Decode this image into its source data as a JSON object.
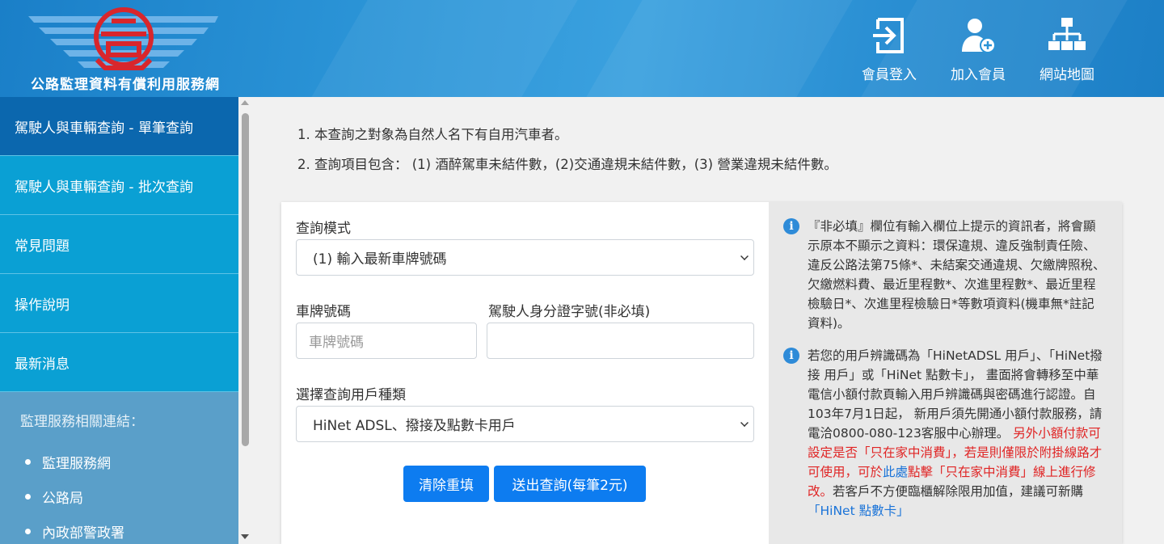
{
  "header": {
    "site_title": "公路監理資料有償利用服務網",
    "nav": [
      {
        "label": "會員登入",
        "icon": "login-icon"
      },
      {
        "label": "加入會員",
        "icon": "add-user-icon"
      },
      {
        "label": "網站地圖",
        "icon": "sitemap-icon"
      }
    ]
  },
  "sidebar": {
    "items": [
      {
        "label": "駕駛人與車輛查詢 - 單筆查詢",
        "active": true
      },
      {
        "label": "駕駛人與車輛查詢 - 批次查詢",
        "active": false
      },
      {
        "label": "常見問題",
        "active": false
      },
      {
        "label": "操作說明",
        "active": false
      },
      {
        "label": "最新消息",
        "active": false
      }
    ],
    "links_title": "監理服務相關連結：",
    "links": [
      "監理服務網",
      "公路局",
      "內政部警政署"
    ]
  },
  "notes": [
    "1. 本查詢之對象為自然人名下有自用汽車者。",
    "2. 查詢項目包含： (1) 酒醉駕車未結件數，(2)交通違規未結件數，(3) 營業違規未結件數。"
  ],
  "form": {
    "mode_label": "查詢模式",
    "mode_value": "(1) 輸入最新車牌號碼",
    "plate_label": "車牌號碼",
    "plate_placeholder": "車牌號碼",
    "plate_value": "",
    "id_label": "駕駛人身分證字號(非必填)",
    "id_value": "",
    "user_type_label": "選擇查詢用戶種類",
    "user_type_value": "HiNet ADSL、撥接及點數卡用戶",
    "clear_button": "清除重填",
    "submit_button": "送出查詢(每筆2元)"
  },
  "info": {
    "block1": "『非必填』欄位有輸入欄位上提示的資訊者，將會顯示原本不顯示之資料：環保違規、違反強制責任險、違反公路法第75條*、未結案交通違規、欠繳牌照稅、欠繳燃料費、最近里程數*、次進里程數*、最近里程檢驗日*、次進里程檢驗日*等數項資料(機車無*註記資料)。",
    "block2_part1": "若您的用戶辨識碼為「HiNetADSL 用戶」、「HiNet撥接 用戶」或「HiNet 點數卡」， 畫面將會轉移至中華電信小額付款頁輸入用戶辨識碼與密碼進行認證。自103年7月1日起， 新用戶須先開通小額付款服務，請電洽0800-080-123客服中心辦理。",
    "block2_red1": "另外小額付款可設定是否「只在家中消費」，若是則僅限於附掛線路才可使用，可於",
    "block2_link1": "此處",
    "block2_red2": "點擊「只在家中消費」線上進行修改。",
    "block2_part2": "若客戶不方便臨櫃解除限用加值，建議可新購",
    "block2_link2": "「HiNet 點數卡」"
  }
}
